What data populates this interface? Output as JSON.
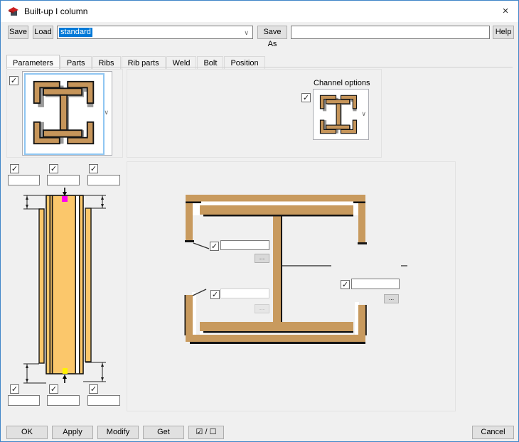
{
  "window": {
    "title": "Built-up I column",
    "close_glyph": "×"
  },
  "toolbar": {
    "save_label": "Save",
    "load_label": "Load",
    "preset_combo": {
      "value": "standard",
      "selected": true
    },
    "save_as_label": "Save As",
    "name_input": {
      "value": "",
      "placeholder": ""
    },
    "help_label": "Help"
  },
  "tabs": [
    "Parameters",
    "Parts",
    "Ribs",
    "Rib parts",
    "Weld",
    "Bolt",
    "Position"
  ],
  "active_tab": "Parameters",
  "profile_panel": {
    "checkbox_checked": true
  },
  "channel_panel": {
    "label": "Channel options",
    "checkbox_checked": true
  },
  "dimension_inputs": {
    "top": [
      {
        "checked": true,
        "value": ""
      },
      {
        "checked": true,
        "value": ""
      },
      {
        "checked": true,
        "value": ""
      }
    ],
    "bottom": [
      {
        "checked": true,
        "value": ""
      },
      {
        "checked": true,
        "value": ""
      },
      {
        "checked": true,
        "value": ""
      }
    ]
  },
  "section_panel": {
    "plate_top": {
      "checked": true,
      "value": "",
      "enabled": true
    },
    "plate_bottom": {
      "checked": true,
      "value": "",
      "enabled": false
    },
    "plate_right": {
      "checked": true,
      "value": "",
      "enabled": true
    }
  },
  "footer": {
    "ok": "OK",
    "apply": "Apply",
    "modify": "Modify",
    "get": "Get",
    "toggle": "☑ / ☐",
    "cancel": "Cancel"
  },
  "icons": {
    "check": "✓",
    "chevron_down": "∨",
    "ellipsis": "..."
  },
  "colors": {
    "accent_blue": "#3f85c8",
    "selection_blue": "#0078d7",
    "steel_tan": "#C89A5E",
    "elevation_yellow": "#FBC76B",
    "handle_magenta": "#FF00F0",
    "handle_yellow": "#FFF200"
  }
}
